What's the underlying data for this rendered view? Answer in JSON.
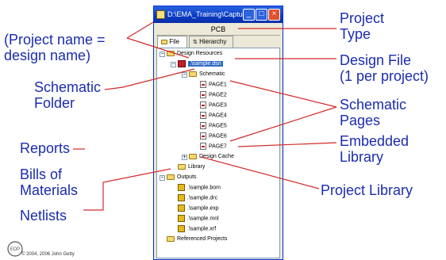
{
  "window": {
    "title": "D:\\EMA_Training\\Capture\\...",
    "project_type": "PCB",
    "tabs": [
      "File",
      "Hierarchy"
    ]
  },
  "tree": {
    "design_resources": "Design Resources",
    "design_file": ".\\sample.dsn",
    "schematic": "Schematic",
    "pages": [
      "PAGE1",
      "PAGE2",
      "PAGE3",
      "PAGE4",
      "PAGE5",
      "PAGE6",
      "PAGE7"
    ],
    "design_cache": "Design Cache",
    "library": "Library",
    "outputs": "Outputs",
    "output_files": [
      ".\\sample.bom",
      ".\\sample.drc",
      ".\\sample.exp",
      ".\\sample.mnl",
      ".\\sample.xrf"
    ],
    "referenced_projects": "Referenced Projects"
  },
  "labels": {
    "project_name": "(Project name =",
    "project_name_2": "design name)",
    "project_type": "Project",
    "project_type_2": "Type",
    "design_file": "Design File",
    "design_file_2": "(1 per project)",
    "schematic_folder": "Schematic",
    "schematic_folder_2": "Folder",
    "schematic_pages": "Schematic",
    "schematic_pages_2": "Pages",
    "embedded_library": "Embedded",
    "embedded_library_2": "Library",
    "project_library": "Project Library",
    "reports": "Reports",
    "bom": "Bills of",
    "bom_2": "Materials",
    "netlists": "Netlists"
  },
  "copyright": "© 2004, 2006 John Getty",
  "logo_text": "EDP",
  "colors": {
    "label": "#1a2cb0",
    "leader": "#d42a2a",
    "titlebar": "#0a3cc6"
  }
}
